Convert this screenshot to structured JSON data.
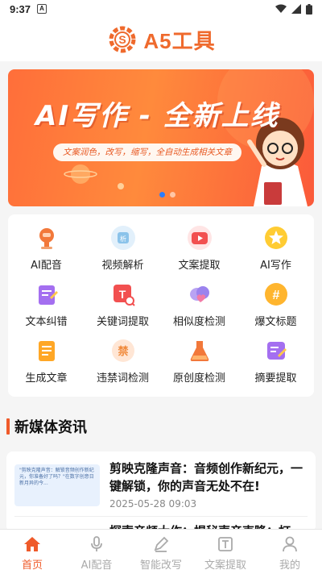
{
  "status": {
    "time": "9:37"
  },
  "header": {
    "logo_text": "A5工具"
  },
  "banner": {
    "title": "AI写作 - 全新上线",
    "subtitle": "文案润色，改写，缩写，全自动生成相关文章"
  },
  "tools": [
    {
      "label": "AI配音",
      "icon": "robot-mic-icon"
    },
    {
      "label": "视频解析",
      "icon": "video-parse-icon"
    },
    {
      "label": "文案提取",
      "icon": "video-play-icon"
    },
    {
      "label": "AI写作",
      "icon": "star-badge-icon"
    },
    {
      "label": "文本纠错",
      "icon": "doc-edit-icon"
    },
    {
      "label": "关键词提取",
      "icon": "text-search-icon"
    },
    {
      "label": "相似度检测",
      "icon": "cloud-heart-icon"
    },
    {
      "label": "爆文标题",
      "icon": "hashtag-icon"
    },
    {
      "label": "生成文章",
      "icon": "document-icon"
    },
    {
      "label": "违禁词检测",
      "icon": "forbidden-word-icon"
    },
    {
      "label": "原创度检测",
      "icon": "flask-icon"
    },
    {
      "label": "摘要提取",
      "icon": "summary-edit-icon"
    }
  ],
  "news_section": {
    "title": "新媒体资讯"
  },
  "news": [
    {
      "headline": "剪映克隆声音：音频创作新纪元，一键解锁，你的声音无处不在!",
      "date": "2025-05-28 09:03",
      "thumb_text": "\"剪映克隆声音：解锁音频创作新纪元，你准备好了吗？\"在数字创意日新月异的今..."
    },
    {
      "headline": "探索音频大作：揭秘声音克隆：打"
    }
  ],
  "tabbar": [
    {
      "label": "首页",
      "icon": "home-icon",
      "active": true
    },
    {
      "label": "AI配音",
      "icon": "mic-icon",
      "active": false
    },
    {
      "label": "智能改写",
      "icon": "pen-icon",
      "active": false
    },
    {
      "label": "文案提取",
      "icon": "text-box-icon",
      "active": false
    },
    {
      "label": "我的",
      "icon": "user-icon",
      "active": false
    }
  ],
  "colors": {
    "accent": "#ef5a2a",
    "tab_inactive": "#aaaaaa"
  }
}
